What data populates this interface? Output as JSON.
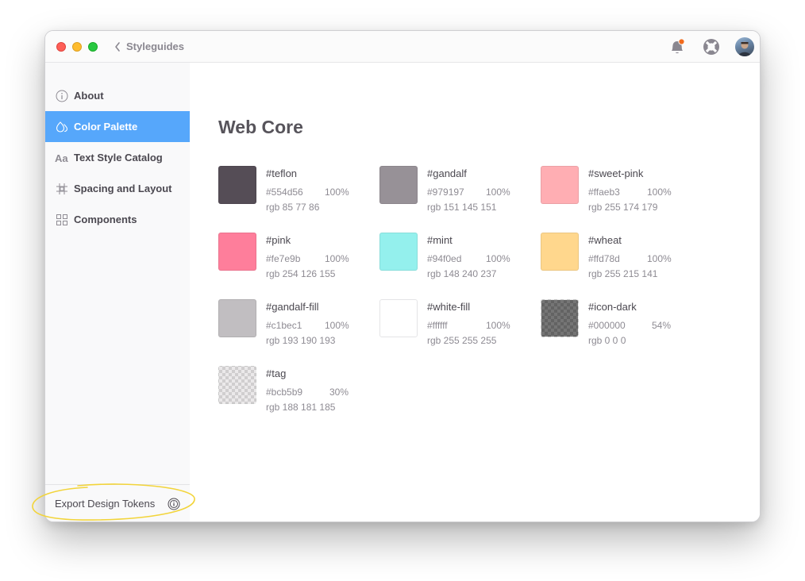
{
  "titlebar": {
    "breadcrumb": "Styleguides",
    "icons": [
      "chevron-left-icon",
      "notification-bell-icon",
      "help-lifebuoy-icon",
      "user-avatar"
    ],
    "notification_dot_color": "#f26b1d"
  },
  "sidebar": {
    "items": [
      {
        "label": "About",
        "icon": "info-icon",
        "active": false
      },
      {
        "label": "Color Palette",
        "icon": "droplets-icon",
        "active": true
      },
      {
        "label": "Text Style Catalog",
        "icon": "text-aa-icon",
        "active": false
      },
      {
        "label": "Spacing and Layout",
        "icon": "spacing-grid-icon",
        "active": false
      },
      {
        "label": "Components",
        "icon": "components-grid-icon",
        "active": false
      }
    ],
    "active_color": "#56a7fb",
    "footer": {
      "label": "Export Design Tokens",
      "icon": "export-info-icon"
    }
  },
  "main": {
    "title": "Web Core",
    "swatches": [
      {
        "name": "#teflon",
        "hex": "#554d56",
        "opacity": "100%",
        "rgb": "rgb 85 77 86",
        "color": "#554d56",
        "alpha": 1.0
      },
      {
        "name": "#gandalf",
        "hex": "#979197",
        "opacity": "100%",
        "rgb": "rgb 151 145 151",
        "color": "#979197",
        "alpha": 1.0
      },
      {
        "name": "#sweet-pink",
        "hex": "#ffaeb3",
        "opacity": "100%",
        "rgb": "rgb 255 174 179",
        "color": "#ffaeb3",
        "alpha": 1.0
      },
      {
        "name": "#pink",
        "hex": "#fe7e9b",
        "opacity": "100%",
        "rgb": "rgb 254 126 155",
        "color": "#fe7e9b",
        "alpha": 1.0
      },
      {
        "name": "#mint",
        "hex": "#94f0ed",
        "opacity": "100%",
        "rgb": "rgb 148 240 237",
        "color": "#94f0ed",
        "alpha": 1.0
      },
      {
        "name": "#wheat",
        "hex": "#ffd78d",
        "opacity": "100%",
        "rgb": "rgb 255 215 141",
        "color": "#ffd78d",
        "alpha": 1.0
      },
      {
        "name": "#gandalf-fill",
        "hex": "#c1bec1",
        "opacity": "100%",
        "rgb": "rgb 193 190 193",
        "color": "#c1bec1",
        "alpha": 1.0
      },
      {
        "name": "#white-fill",
        "hex": "#ffffff",
        "opacity": "100%",
        "rgb": "rgb 255 255 255",
        "color": "#ffffff",
        "alpha": 1.0
      },
      {
        "name": "#icon-dark",
        "hex": "#000000",
        "opacity": "54%",
        "rgb": "rgb 0 0 0",
        "color": "#000000",
        "alpha": 0.54
      },
      {
        "name": "#tag",
        "hex": "#bcb5b9",
        "opacity": "30%",
        "rgb": "rgb 188 181 185",
        "color": "#bcb5b9",
        "alpha": 0.3
      }
    ]
  }
}
